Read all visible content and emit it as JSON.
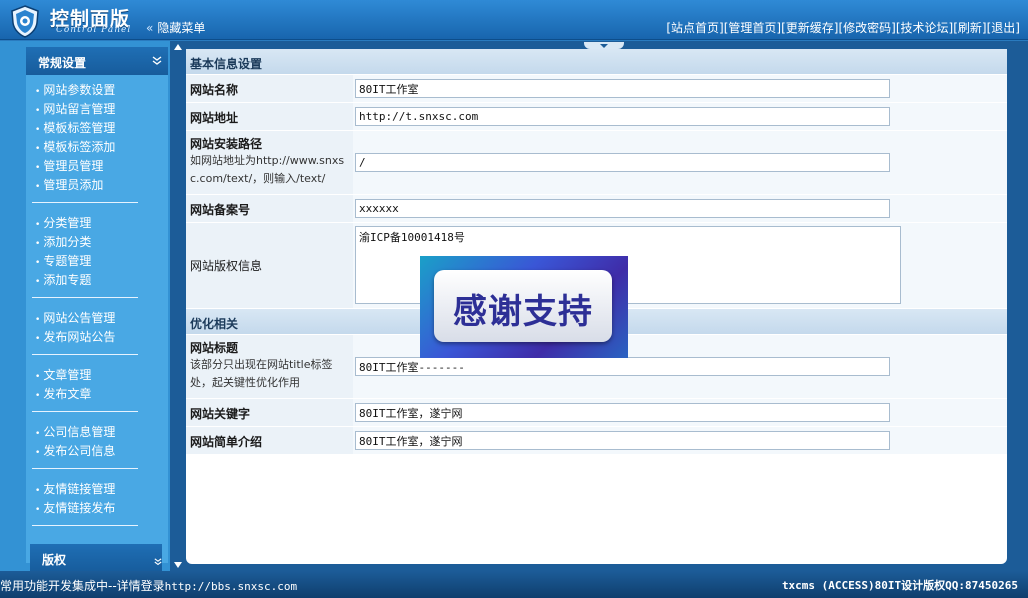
{
  "header": {
    "title": "控制面版",
    "subtitle": "Control Panel",
    "hide_menu": "隐藏菜单",
    "nav": [
      "[站点首页]",
      "[管理首页]",
      "[更新缓存]",
      "[修改密码]",
      "[技术论坛]",
      "[刷新]",
      "[退出]"
    ]
  },
  "sidebar": {
    "heading": "常规设置",
    "groups": [
      [
        "网站参数设置",
        "网站留言管理",
        "模板标签管理",
        "模板标签添加",
        "管理员管理",
        "管理员添加"
      ],
      [
        "分类管理",
        "添加分类",
        "专题管理",
        "添加专题"
      ],
      [
        "网站公告管理",
        "发布网站公告"
      ],
      [
        "文章管理",
        "发布文章"
      ],
      [
        "公司信息管理",
        "发布公司信息"
      ],
      [
        "友情链接管理",
        "友情链接发布"
      ]
    ],
    "footer_heading": "版权"
  },
  "form": {
    "section1": "基本信息设置",
    "site_name_label": "网站名称",
    "site_name_value": "80IT工作室",
    "site_url_label": "网站地址",
    "site_url_value": "http://t.snxsc.com",
    "install_path_label": "网站安装路径",
    "install_path_note": "如网站地址为http://www.snxsc.com/text/，则输入/text/",
    "install_path_value": "/",
    "icp_label": "网站备案号",
    "icp_value": "xxxxxx",
    "copyright_label": "网站版权信息",
    "copyright_value": "渝ICP备10001418号",
    "section2": "优化相关",
    "seo_title_label": "网站标题",
    "seo_title_note": "该部分只出现在网站title标签处，起关键性优化作用",
    "seo_title_value": "80IT工作室-------",
    "keywords_label": "网站关键字",
    "keywords_value": "80IT工作室，遂宁网",
    "description_label": "网站简单介绍",
    "description_value": "80IT工作室，遂宁网"
  },
  "overlay": {
    "text": "感谢支持"
  },
  "footer": {
    "left_text": "常用功能开发集成中--详情登录",
    "left_url": "http://bbs.snxsc.com",
    "right_text": "txcms (ACCESS)80IT设计版权QQ:87450265"
  },
  "colors": {
    "header_bg": "#1f74c2",
    "sidebar_bg": "#49a8e4",
    "section_head_bg": "#c9dcee",
    "frame_dark": "#1c5c98"
  }
}
